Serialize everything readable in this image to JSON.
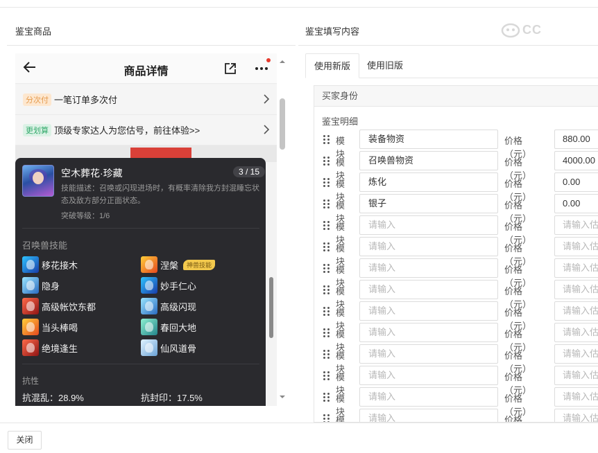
{
  "left_section": {
    "title": "鉴宝商品"
  },
  "right_section": {
    "title": "鉴宝填写内容"
  },
  "watermark": {
    "text": "CC"
  },
  "phone": {
    "title": "商品详情",
    "promo_rows": [
      {
        "tag": "分次付",
        "text": "一笔订单多次付"
      },
      {
        "tag": "更划算",
        "text": "顶级专家达人为您估号，前往体验>>"
      }
    ]
  },
  "skill_popup": {
    "name": "空木葬花·珍藏",
    "counter": "3 / 15",
    "description": "技能描述：召唤或闪现进场时，有概率清除我方封混睡忘状态及敌方部分正面状态。",
    "breakthrough": "突破等级：1/6",
    "skills_title": "召唤兽技能",
    "skills": [
      {
        "name": "移花接木",
        "icon": "skill-swap-icon",
        "badge": ""
      },
      {
        "name": "涅槃",
        "icon": "skill-nirvana-icon",
        "badge": "神兽技能"
      },
      {
        "name": "隐身",
        "icon": "skill-stealth-icon",
        "badge": ""
      },
      {
        "name": "妙手仁心",
        "icon": "skill-heal-icon",
        "badge": ""
      },
      {
        "name": "高级帐饮东都",
        "icon": "skill-feast-icon",
        "badge": ""
      },
      {
        "name": "高级闪现",
        "icon": "skill-flash-icon",
        "badge": ""
      },
      {
        "name": "当头棒喝",
        "icon": "skill-strike-icon",
        "badge": ""
      },
      {
        "name": "春回大地",
        "icon": "skill-spring-icon",
        "badge": ""
      },
      {
        "name": "绝境逢生",
        "icon": "skill-revive-icon",
        "badge": ""
      },
      {
        "name": "仙风道骨",
        "icon": "skill-immortal-icon",
        "badge": ""
      }
    ],
    "resist_title": "抗性",
    "resists": [
      {
        "label": "抗混乱：28.9%"
      },
      {
        "label": "抗封印：17.5%"
      }
    ]
  },
  "tabs": [
    {
      "label": "使用新版"
    },
    {
      "label": "使用旧版"
    }
  ],
  "form": {
    "buyer_header": "买家身份",
    "detail_title": "鉴宝明细",
    "module_label": "模块",
    "price_label": "价格（元）",
    "input_placeholder": "请输入",
    "price_placeholder": "请输入估价",
    "rows": [
      {
        "module": "装备物资",
        "price": "880.00"
      },
      {
        "module": "召唤兽物资",
        "price": "4000.00"
      },
      {
        "module": "炼化",
        "price": "0.00"
      },
      {
        "module": "银子",
        "price": "0.00"
      },
      {
        "module": "",
        "price": ""
      },
      {
        "module": "",
        "price": ""
      },
      {
        "module": "",
        "price": ""
      },
      {
        "module": "",
        "price": ""
      },
      {
        "module": "",
        "price": ""
      },
      {
        "module": "",
        "price": ""
      },
      {
        "module": "",
        "price": ""
      },
      {
        "module": "",
        "price": ""
      },
      {
        "module": "",
        "price": ""
      },
      {
        "module": "",
        "price": ""
      }
    ]
  },
  "footer": {
    "close_label": "关闭"
  }
}
